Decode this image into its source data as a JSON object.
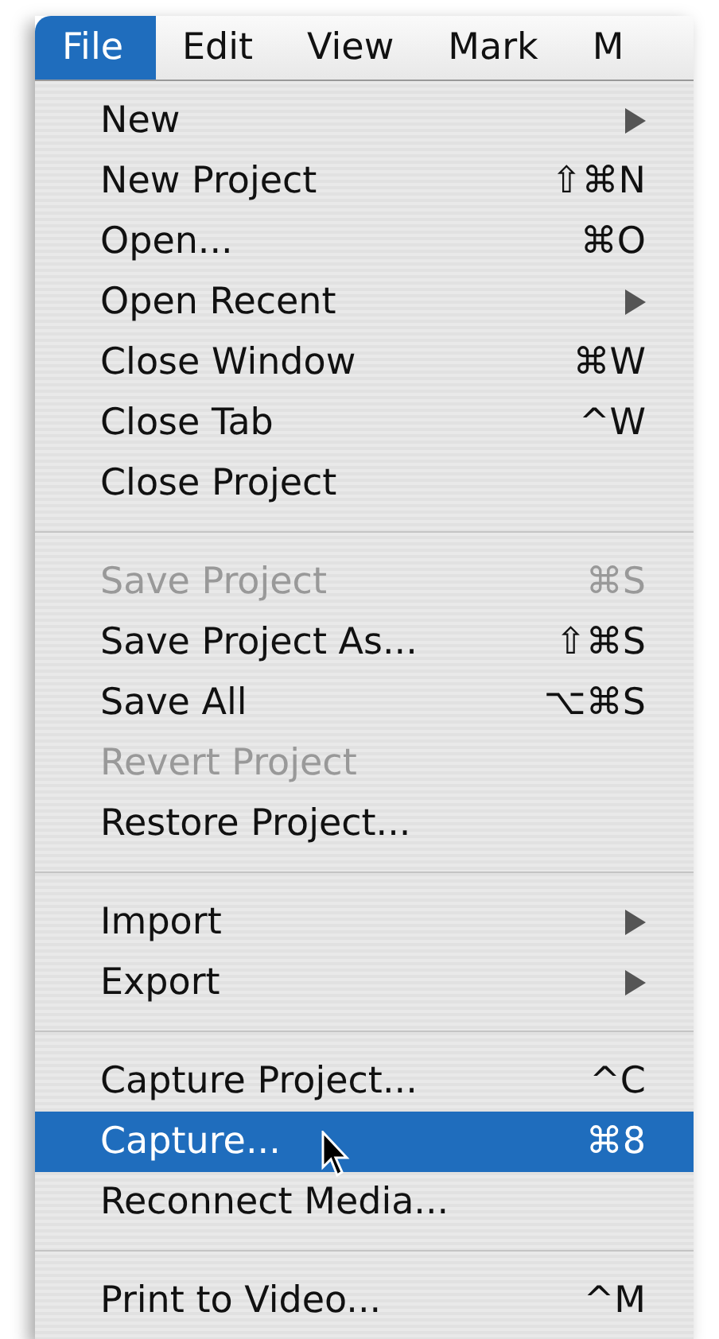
{
  "menu_bar": [
    {
      "label": "File",
      "selected": true
    },
    {
      "label": "Edit",
      "selected": false
    },
    {
      "label": "View",
      "selected": false
    },
    {
      "label": "Mark",
      "selected": false
    },
    {
      "label": "M",
      "selected": false
    }
  ],
  "menu": {
    "sections": [
      [
        {
          "label": "New",
          "submenu": true,
          "disabled": false,
          "selected": false
        },
        {
          "label": "New Project",
          "shortcut": "⇧⌘N",
          "submenu": false,
          "disabled": false,
          "selected": false
        },
        {
          "label": "Open...",
          "shortcut": "⌘O",
          "submenu": false,
          "disabled": false,
          "selected": false
        },
        {
          "label": "Open Recent",
          "submenu": true,
          "disabled": false,
          "selected": false
        },
        {
          "label": "Close Window",
          "shortcut": "⌘W",
          "submenu": false,
          "disabled": false,
          "selected": false
        },
        {
          "label": "Close Tab",
          "shortcut": "^W",
          "submenu": false,
          "disabled": false,
          "selected": false
        },
        {
          "label": "Close Project",
          "submenu": false,
          "disabled": false,
          "selected": false
        }
      ],
      [
        {
          "label": "Save Project",
          "shortcut": "⌘S",
          "submenu": false,
          "disabled": true,
          "selected": false
        },
        {
          "label": "Save Project As...",
          "shortcut": "⇧⌘S",
          "submenu": false,
          "disabled": false,
          "selected": false
        },
        {
          "label": "Save All",
          "shortcut": "⌥⌘S",
          "submenu": false,
          "disabled": false,
          "selected": false
        },
        {
          "label": "Revert Project",
          "submenu": false,
          "disabled": true,
          "selected": false
        },
        {
          "label": "Restore Project...",
          "submenu": false,
          "disabled": false,
          "selected": false
        }
      ],
      [
        {
          "label": "Import",
          "submenu": true,
          "disabled": false,
          "selected": false
        },
        {
          "label": "Export",
          "submenu": true,
          "disabled": false,
          "selected": false
        }
      ],
      [
        {
          "label": "Capture Project...",
          "shortcut": "^C",
          "submenu": false,
          "disabled": false,
          "selected": false
        },
        {
          "label": "Capture...",
          "shortcut": "⌘8",
          "submenu": false,
          "disabled": false,
          "selected": true
        },
        {
          "label": "Reconnect Media...",
          "submenu": false,
          "disabled": false,
          "selected": false
        }
      ],
      [
        {
          "label": "Print to Video...",
          "shortcut": "^M",
          "submenu": false,
          "disabled": false,
          "selected": false
        }
      ]
    ]
  }
}
